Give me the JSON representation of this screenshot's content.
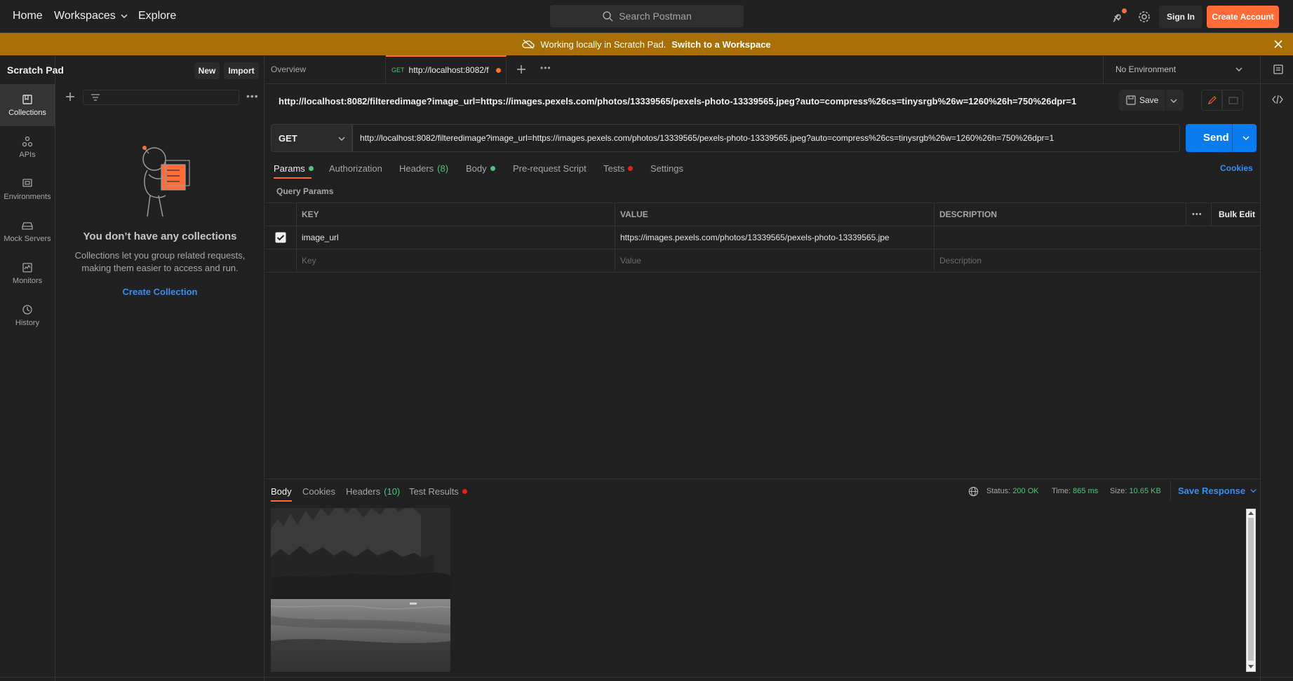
{
  "nav": {
    "home": "Home",
    "workspaces": "Workspaces",
    "explore": "Explore",
    "search_placeholder": "Search Postman",
    "sign_in": "Sign In",
    "create_account": "Create Account"
  },
  "banner": {
    "text": "Working locally in Scratch Pad.",
    "link": "Switch to a Workspace"
  },
  "rail": {
    "items": [
      {
        "label": "Collections",
        "icon": "collections-icon",
        "active": true
      },
      {
        "label": "APIs",
        "icon": "apis-icon"
      },
      {
        "label": "Environments",
        "icon": "environments-icon"
      },
      {
        "label": "Mock Servers",
        "icon": "mock-servers-icon"
      },
      {
        "label": "Monitors",
        "icon": "monitors-icon"
      },
      {
        "label": "History",
        "icon": "history-icon"
      }
    ]
  },
  "sidebar": {
    "title": "Scratch Pad",
    "new": "New",
    "import": "Import",
    "empty_title": "You don’t have any collections",
    "empty_line1": "Collections let you group related requests,",
    "empty_line2": "making them easier to access and run.",
    "create_collection": "Create Collection"
  },
  "tabs": {
    "overview": "Overview",
    "active_method": "GET",
    "active_label": "http://localhost:8082/f",
    "environment": "No Environment"
  },
  "request": {
    "title_url": "http://localhost:8082/filteredimage?image_url=https://images.pexels.com/photos/13339565/pexels-photo-13339565.jpeg?auto=compress%26cs=tinysrgb%26w=1260%26h=750%26dpr=1",
    "save": "Save",
    "method": "GET",
    "url": "http://localhost:8082/filteredimage?image_url=https://images.pexels.com/photos/13339565/pexels-photo-13339565.jpeg?auto=compress%26cs=tinysrgb%26w=1260%26h=750%26dpr=1",
    "send": "Send",
    "tabs": {
      "params": "Params",
      "authorization": "Authorization",
      "headers": "Headers",
      "headers_count": "(8)",
      "body": "Body",
      "pre_request": "Pre-request Script",
      "tests": "Tests",
      "settings": "Settings"
    },
    "cookies": "Cookies",
    "query_params": "Query Params"
  },
  "params": {
    "headers": {
      "key": "KEY",
      "value": "VALUE",
      "description": "DESCRIPTION",
      "bulk_edit": "Bulk Edit"
    },
    "rows": [
      {
        "key": "image_url",
        "value": "https://images.pexels.com/photos/13339565/pexels-photo-13339565.jpe",
        "checked": true
      }
    ],
    "placeholder": {
      "key": "Key",
      "value": "Value",
      "description": "Description"
    }
  },
  "response": {
    "tabs": {
      "body": "Body",
      "cookies": "Cookies",
      "headers": "Headers",
      "headers_count": "(10)",
      "test_results": "Test Results"
    },
    "status_label": "Status:",
    "status_value": "200 OK",
    "time_label": "Time:",
    "time_value": "865 ms",
    "size_label": "Size:",
    "size_value": "10.65 KB",
    "save_response": "Save Response"
  },
  "colors": {
    "accent": "#ff6c37",
    "banner": "#a86f06",
    "primary_blue": "#097bed",
    "success_green": "#4fc37e",
    "error_red": "#eb2013"
  }
}
